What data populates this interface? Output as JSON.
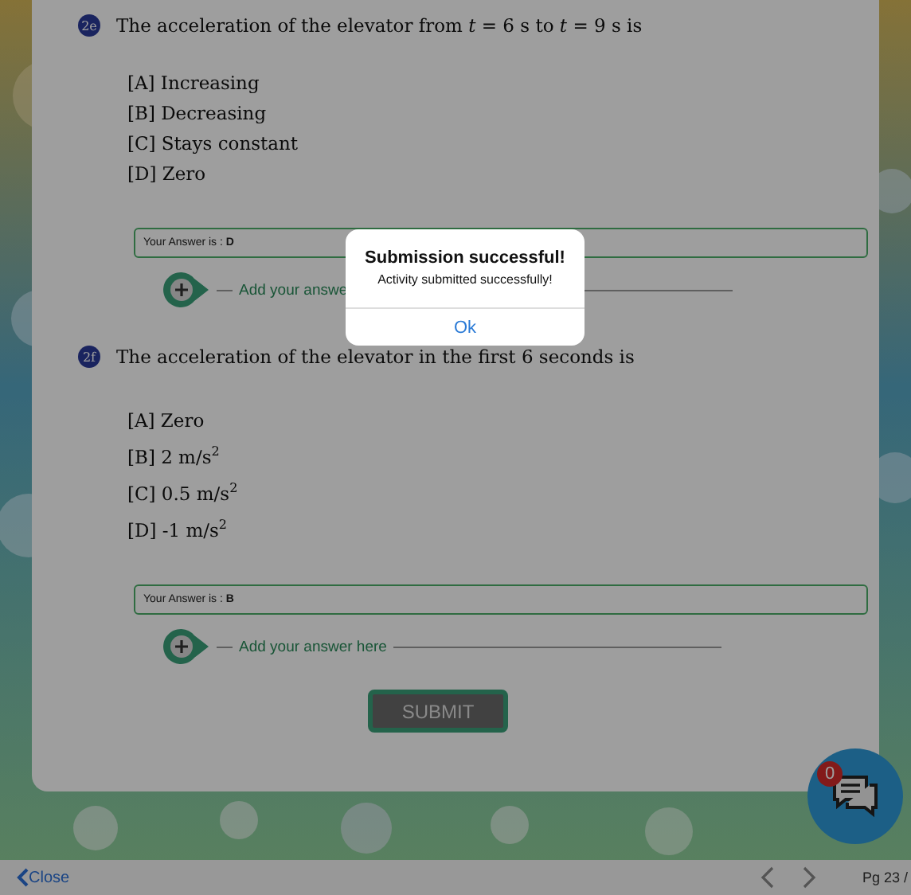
{
  "questions": [
    {
      "badge": "2e",
      "text": "The acceleration of the elevator from *t* = 6 s to *t* = 9 s is",
      "options": [
        "[A] Increasing",
        "[B] Decreasing",
        "[C] Stays constant",
        "[D] Zero"
      ],
      "answer": "Your Answer is : **D**",
      "add_answer": "Add your answe"
    },
    {
      "badge": "2f",
      "text": "The acceleration of the elevator in the first 6 seconds is",
      "options": [
        "[A] Zero",
        "[B] 2 m/s$^{2}$",
        "[C] 0.5 m/s$^{2}$",
        "[D] -1 m/s$^{2}$"
      ],
      "answer": "Your Answer is : **B**",
      "add_answer": "Add your answer here"
    }
  ],
  "submit_button": "SUBMIT",
  "chat": {
    "count": "0"
  },
  "bottom_bar": {
    "close": "Close",
    "page": "Pg 23 /"
  },
  "alert": {
    "title": "Submission successful!",
    "message": "Activity submitted successfully!",
    "button": "Ok"
  }
}
